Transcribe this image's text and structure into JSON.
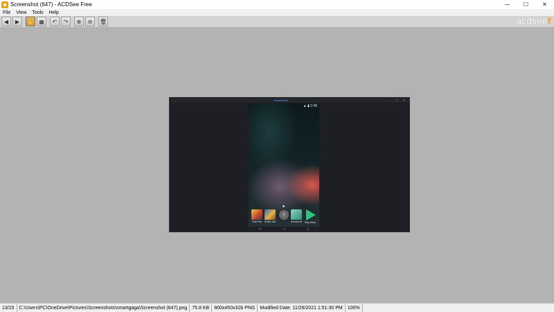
{
  "window": {
    "title": "Screenshot (647) - ACDSee Free",
    "minimize_glyph": "—",
    "maximize_glyph": "☐",
    "close_glyph": "✕"
  },
  "menu": {
    "items": [
      {
        "label": "File"
      },
      {
        "label": "View"
      },
      {
        "label": "Tools"
      },
      {
        "label": "Help"
      }
    ]
  },
  "toolbar": {
    "buttons": [
      {
        "icon": "back-arrow-icon",
        "glyph": "◀"
      },
      {
        "icon": "forward-arrow-icon",
        "glyph": "▶"
      },
      {
        "icon": "hand-pan-icon",
        "glyph": "✋"
      },
      {
        "icon": "select-icon",
        "glyph": "▦"
      },
      {
        "icon": "rotate-left-icon",
        "glyph": "↶"
      },
      {
        "icon": "rotate-right-icon",
        "glyph": "↷"
      },
      {
        "icon": "zoom-in-icon",
        "glyph": "⊕"
      },
      {
        "icon": "zoom-out-icon",
        "glyph": "⊖"
      },
      {
        "icon": "delete-icon",
        "glyph": "🗑"
      }
    ],
    "brand": {
      "text": "acdsee",
      "accent": "f",
      "accent_color": "#f2b134"
    }
  },
  "image": {
    "app_title": "SmartGaGa",
    "window_buttons": "– □ ✕",
    "status": "▲ ▮ 2:48",
    "dock_apps": [
      {
        "label": "Free Fire",
        "icon": "free-fire-icon"
      },
      {
        "label": "PUBG MO",
        "icon": "pubg-icon"
      },
      {
        "label": "",
        "icon": "app-launcher-icon",
        "glyph": "⠿"
      },
      {
        "label": "Summit W",
        "icon": "summit-icon"
      },
      {
        "label": "Play Store",
        "icon": "play-store-icon"
      }
    ],
    "nav": {
      "back": "↩",
      "home": "▭",
      "recent": "▯"
    }
  },
  "status": {
    "position": "13/15",
    "path": "C:\\Users\\PC\\OneDrive\\Pictures\\Screenshots\\smartgaga\\Screenshot (647).png",
    "size": "75.8 KB",
    "dimensions": "800x450x32b PNG",
    "modified": "Modified Date: 11/26/2021 1:51:30 PM",
    "zoom": "100%"
  }
}
